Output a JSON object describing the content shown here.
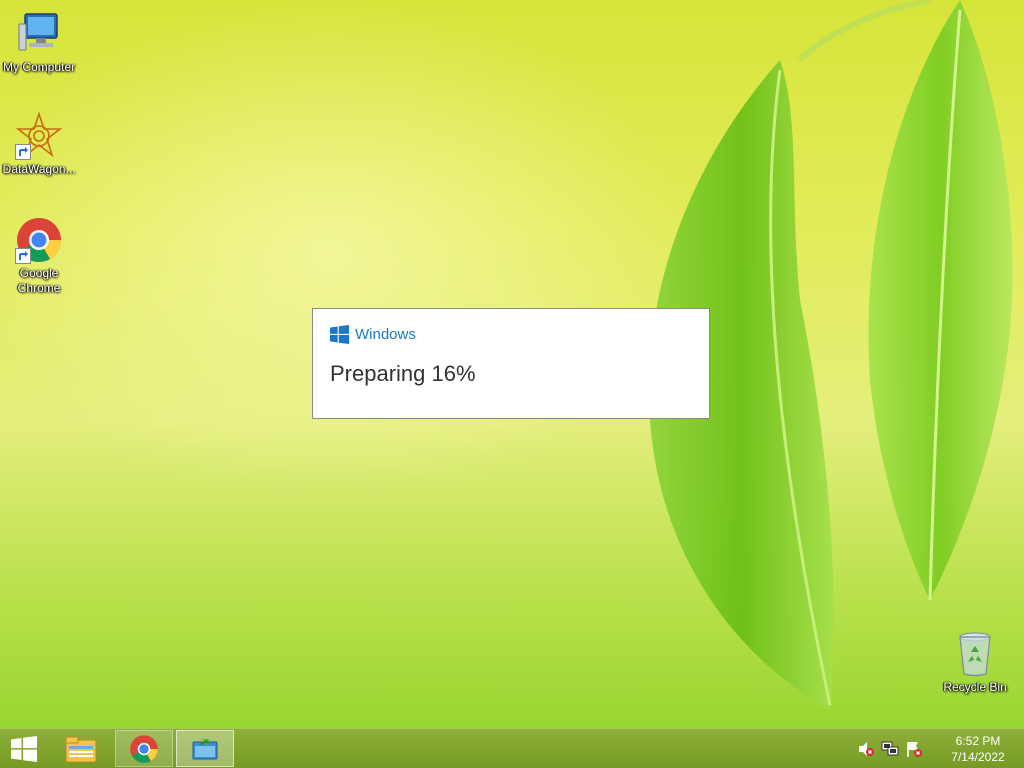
{
  "desktop": {
    "icons": [
      {
        "label": "My Computer",
        "icon": "computer-icon"
      },
      {
        "label": "DataWagon...",
        "icon": "datawagon-icon"
      },
      {
        "label": "Google Chrome",
        "icon": "chrome-icon"
      },
      {
        "label": "Recycle Bin",
        "icon": "recycle-bin-icon"
      }
    ]
  },
  "dialog": {
    "brand": "Windows",
    "status": "Preparing 16%",
    "brand_color": "#1979c9"
  },
  "taskbar": {
    "items": [
      {
        "icon": "windows-start-icon"
      },
      {
        "icon": "file-explorer-icon"
      },
      {
        "icon": "chrome-icon"
      },
      {
        "icon": "app-window-icon"
      }
    ],
    "tray": [
      {
        "icon": "volume-muted-icon"
      },
      {
        "icon": "network-icon"
      },
      {
        "icon": "action-center-flag-icon"
      }
    ],
    "clock": {
      "time": "6:52 PM",
      "date": "7/14/2022"
    }
  }
}
